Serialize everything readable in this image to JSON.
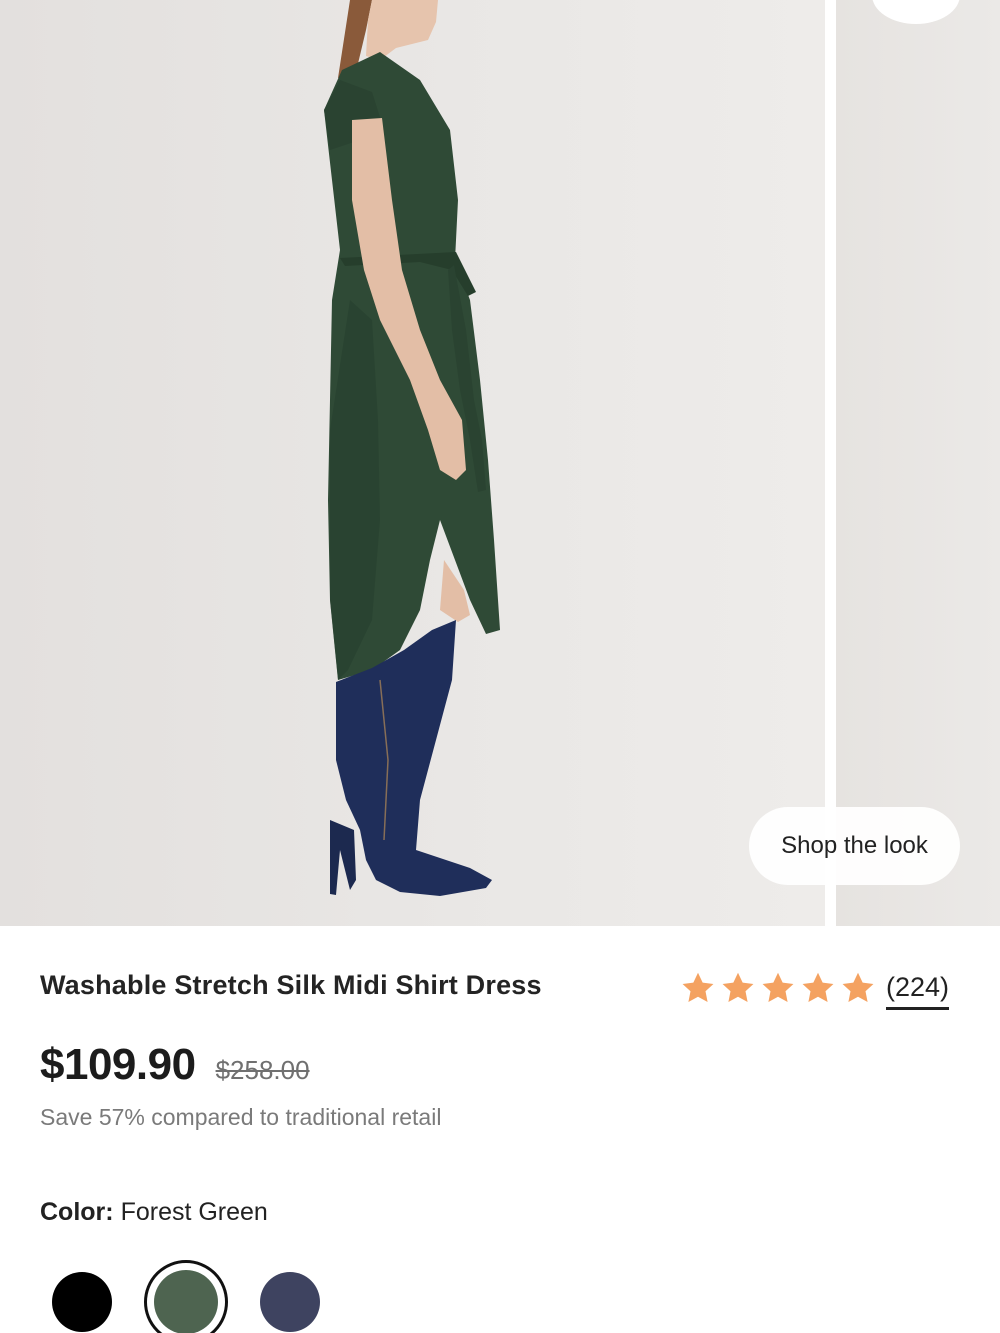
{
  "gallery": {
    "shop_the_look_label": "Shop the look"
  },
  "product": {
    "title": "Washable Stretch Silk Midi Shirt Dress",
    "rating": {
      "stars": 5,
      "icon": "star-icon",
      "star_color": "#f4a261",
      "review_count": "(224)"
    },
    "price": "$109.90",
    "original_price": "$258.00",
    "savings_text": "Save 57% compared to traditional retail",
    "color": {
      "label": "Color:",
      "selected": "Forest Green",
      "swatches": [
        {
          "name": "black",
          "hex": "#000000"
        },
        {
          "name": "forest green",
          "hex": "#4e6450",
          "selected": true
        },
        {
          "name": "navy",
          "hex": "#3e4360"
        }
      ]
    }
  }
}
